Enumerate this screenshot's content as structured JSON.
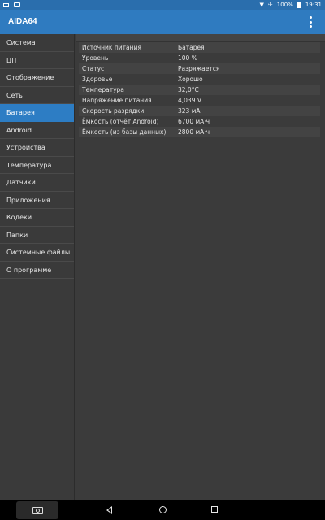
{
  "status_bar": {
    "battery_percent": "100%",
    "time": "19:31"
  },
  "app": {
    "title": "AIDA64"
  },
  "sidebar": {
    "items": [
      {
        "label": "Система"
      },
      {
        "label": "ЦП"
      },
      {
        "label": "Отображение"
      },
      {
        "label": "Сеть"
      },
      {
        "label": "Батарея"
      },
      {
        "label": "Android"
      },
      {
        "label": "Устройства"
      },
      {
        "label": "Температура"
      },
      {
        "label": "Датчики"
      },
      {
        "label": "Приложения"
      },
      {
        "label": "Кодеки"
      },
      {
        "label": "Папки"
      },
      {
        "label": "Системные файлы"
      },
      {
        "label": "О программе"
      }
    ],
    "active_index": 4
  },
  "battery": {
    "rows": [
      {
        "key": "Источник питания",
        "value": "Батарея"
      },
      {
        "key": "Уровень",
        "value": "100 %"
      },
      {
        "key": "Статус",
        "value": "Разряжается"
      },
      {
        "key": "Здоровье",
        "value": "Хорошо"
      },
      {
        "key": "Температура",
        "value": "32,0°C"
      },
      {
        "key": "Напряжение питания",
        "value": "4,039 V"
      },
      {
        "key": "Скорость разрядки",
        "value": "323 мА"
      },
      {
        "key": "Ёмкость (отчёт Android)",
        "value": "6700 мА·ч"
      },
      {
        "key": "Ёмкость (из базы данных)",
        "value": "2800 мА·ч"
      }
    ]
  },
  "colors": {
    "status_bar": "#2a6ead",
    "app_bar": "#2f7bc0",
    "active_item": "#2d7dc4",
    "background": "#3b3b3b"
  },
  "icons": {
    "status_left": [
      "image-icon",
      "screen-icon"
    ],
    "status_right": [
      "wifi-icon",
      "airplane-mode-icon",
      "battery-icon"
    ],
    "app_bar": [
      "overflow-menu-icon"
    ],
    "nav_bar": [
      "camera-icon",
      "back-icon",
      "home-icon",
      "recents-icon"
    ]
  }
}
